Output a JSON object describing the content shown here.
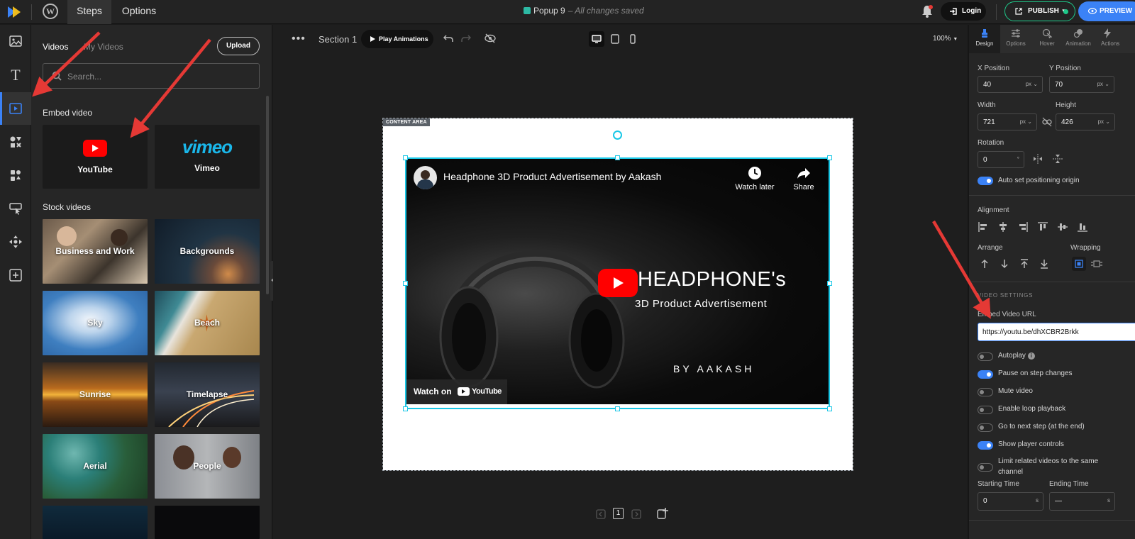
{
  "topbar": {
    "tabs": [
      {
        "label": "Steps",
        "active": true
      },
      {
        "label": "Options",
        "active": false
      }
    ],
    "doc_title": "Popup 9",
    "doc_status": "– All changes saved",
    "login_label": "Login",
    "publish_label": "PUBLISH",
    "preview_label": "PREVIEW",
    "colors": {
      "accent": "#3b82f6",
      "publish": "#1ec98a"
    }
  },
  "panel": {
    "tabs": [
      {
        "label": "Videos",
        "active": true
      },
      {
        "label": "My Videos",
        "active": false
      }
    ],
    "upload_label": "Upload",
    "search_placeholder": "Search...",
    "embed_title": "Embed video",
    "embed_options": [
      {
        "label": "YouTube",
        "icon": "youtube-icon"
      },
      {
        "label": "Vimeo",
        "icon": "vimeo-logo"
      }
    ],
    "vimeo_logo_text": "vimeo",
    "stock_title": "Stock videos",
    "stock_items": [
      "Business and Work",
      "Backgrounds",
      "Sky",
      "Beach",
      "Sunrise",
      "Timelapse",
      "Aerial",
      "People"
    ]
  },
  "canvas": {
    "section_name": "Section 1",
    "play_animations": "Play Animations",
    "zoom": "100%",
    "content_area_label": "CONTENT AREA",
    "video": {
      "title": "Headphone 3D Product Advertisement by Aakash",
      "watch_later": "Watch later",
      "share": "Share",
      "headline": "HEADPHONE's",
      "subline": "3D Product Advertisement",
      "byline": "BY AAKASH",
      "watch_on": "Watch on",
      "youtube_word": "YouTube"
    },
    "page_number": "1"
  },
  "props": {
    "tabs": [
      {
        "label": "Design",
        "active": true
      },
      {
        "label": "Options",
        "active": false
      },
      {
        "label": "Hover",
        "active": false
      },
      {
        "label": "Animation",
        "active": false
      },
      {
        "label": "Actions",
        "active": false
      }
    ],
    "x_position_label": "X Position",
    "x_position": "40",
    "y_position_label": "Y Position",
    "y_position": "70",
    "width_label": "Width",
    "width": "721",
    "height_label": "Height",
    "height": "426",
    "unit": "px",
    "rotation_label": "Rotation",
    "rotation": "0",
    "rotation_unit": "°",
    "auto_origin_label": "Auto set positioning origin",
    "alignment_label": "Alignment",
    "arrange_label": "Arrange",
    "wrapping_label": "Wrapping",
    "video_settings_header": "VIDEO SETTINGS",
    "embed_url_label": "Embed Video URL",
    "embed_url": "https://youtu.be/dhXCBR2Brkk",
    "toggles": [
      {
        "label": "Autoplay",
        "on": false
      },
      {
        "label": "Pause on step changes",
        "on": true
      },
      {
        "label": "Mute video",
        "on": false
      },
      {
        "label": "Enable loop playback",
        "on": false
      },
      {
        "label": "Go to next step (at the end)",
        "on": false
      },
      {
        "label": "Show player controls",
        "on": true
      },
      {
        "label": "Limit related videos to the same channel",
        "on": false
      }
    ],
    "starting_time_label": "Starting Time",
    "starting_time": "0",
    "ending_time_label": "Ending Time",
    "ending_time": "—",
    "time_unit": "s"
  }
}
